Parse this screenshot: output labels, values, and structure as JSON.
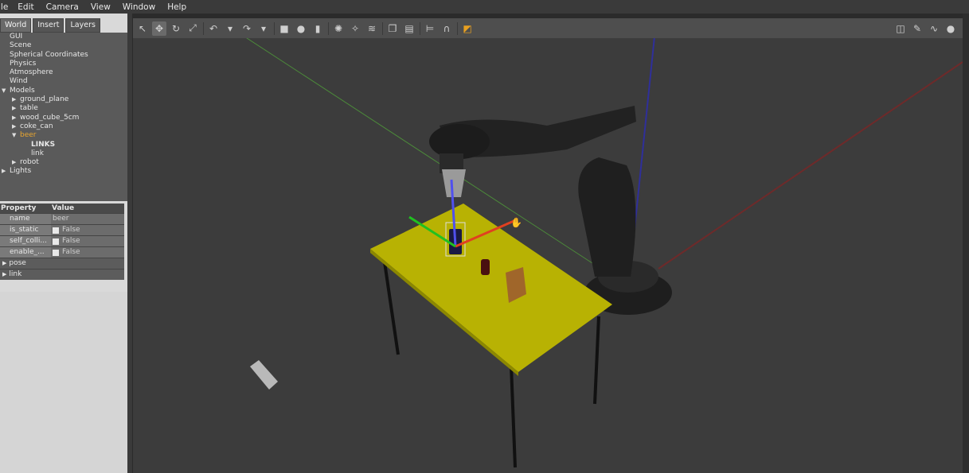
{
  "menu": [
    "ile",
    "Edit",
    "Camera",
    "View",
    "Window",
    "Help"
  ],
  "tabs": [
    "World",
    "Insert",
    "Layers"
  ],
  "tree": [
    {
      "label": "GUI",
      "level": 0
    },
    {
      "label": "Scene",
      "level": 0
    },
    {
      "label": "Spherical Coordinates",
      "level": 0
    },
    {
      "label": "Physics",
      "level": 0
    },
    {
      "label": "Atmosphere",
      "level": 0
    },
    {
      "label": "Wind",
      "level": 0
    },
    {
      "label": "Models",
      "level": 0,
      "arrow": "down"
    },
    {
      "label": "ground_plane",
      "level": 1,
      "arrow": "right"
    },
    {
      "label": "table",
      "level": 1,
      "arrow": "right"
    },
    {
      "label": "wood_cube_5cm",
      "level": 1,
      "arrow": "right"
    },
    {
      "label": "coke_can",
      "level": 1,
      "arrow": "right"
    },
    {
      "label": "beer",
      "level": 1,
      "arrow": "down",
      "selected": true
    },
    {
      "label": "LINKS",
      "level": 2,
      "bold": true
    },
    {
      "label": "link",
      "level": 2
    },
    {
      "label": "robot",
      "level": 1,
      "arrow": "right"
    },
    {
      "label": "Lights",
      "level": 0,
      "arrow": "right"
    }
  ],
  "properties": {
    "header": {
      "property": "Property",
      "value": "Value"
    },
    "rows": [
      {
        "key": "name",
        "value": "beer",
        "checkbox": false
      },
      {
        "key": "is_static",
        "value": "False",
        "checkbox": true
      },
      {
        "key": "self_colli...",
        "value": "False",
        "checkbox": true
      },
      {
        "key": "enable_...",
        "value": "False",
        "checkbox": true
      }
    ],
    "groups": [
      "pose",
      "link"
    ]
  },
  "toolbar": {
    "left": [
      "select-arrow-icon",
      "translate-icon",
      "rotate-icon",
      "scale-icon",
      "undo-icon",
      "undo-history-icon",
      "redo-icon",
      "redo-history-icon",
      "box-icon",
      "sphere-icon",
      "cylinder-icon",
      "point-light-icon",
      "spot-light-icon",
      "directional-light-icon",
      "copy-icon",
      "paste-icon",
      "align-icon",
      "snap-icon",
      "view-angle-icon"
    ],
    "right": [
      "screenshot-icon",
      "log-icon",
      "plot-icon",
      "video-icon"
    ]
  }
}
